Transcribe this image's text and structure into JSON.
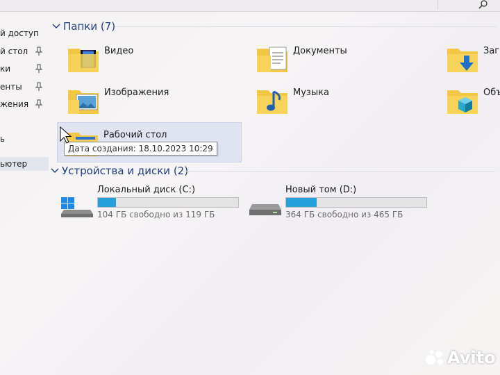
{
  "sidebar": {
    "items": [
      {
        "label": "й доступ",
        "pinned": false
      },
      {
        "label": "й стол",
        "pinned": true
      },
      {
        "label": "ки",
        "pinned": true
      },
      {
        "label": "енты",
        "pinned": true
      },
      {
        "label": "жения",
        "pinned": true
      },
      {
        "label": "ь",
        "pinned": false
      },
      {
        "label": "ьютер",
        "pinned": false
      }
    ]
  },
  "folders_group": {
    "title": "Папки (7)"
  },
  "folders": [
    {
      "label": "Видео",
      "icon": "video-folder-icon"
    },
    {
      "label": "Документы",
      "icon": "documents-folder-icon"
    },
    {
      "label": "Загру",
      "icon": "downloads-folder-icon"
    },
    {
      "label": "Изображения",
      "icon": "pictures-folder-icon"
    },
    {
      "label": "Музыка",
      "icon": "music-folder-icon"
    },
    {
      "label": "Объе",
      "icon": "3d-objects-folder-icon"
    },
    {
      "label": "Рабочий стол",
      "icon": "desktop-folder-icon"
    }
  ],
  "tooltip": {
    "text": "Дата создания: 18.10.2023 10:29"
  },
  "drives_group": {
    "title": "Устройства и диски (2)"
  },
  "drives": [
    {
      "label": "Локальный диск (C:)",
      "free_text": "104 ГБ свободно из 119 ГБ",
      "used_fraction": 0.13,
      "icon": "system-drive-icon"
    },
    {
      "label": "Новый том (D:)",
      "free_text": "364 ГБ свободно из 465 ГБ",
      "used_fraction": 0.22,
      "icon": "hard-drive-icon"
    }
  ],
  "watermark": {
    "text": "Avito"
  },
  "colors": {
    "accent": "#26a0da",
    "header": "#1f3d7a",
    "folder": "#f2c744"
  }
}
